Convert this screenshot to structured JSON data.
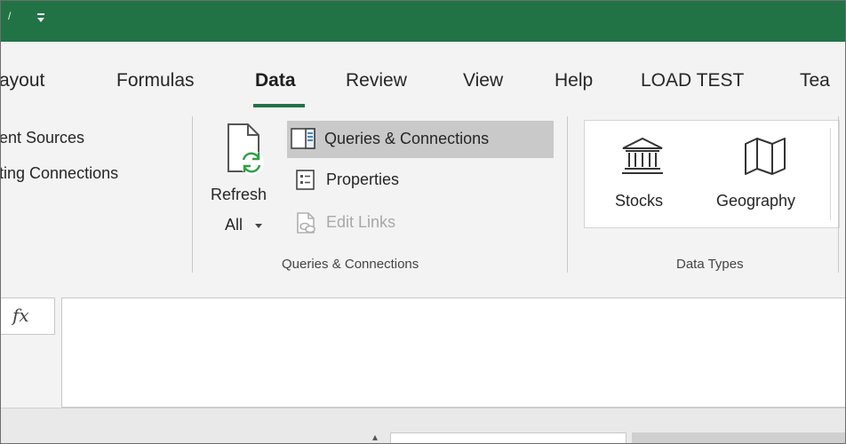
{
  "title_bar": {
    "qat_glyph": "/",
    "customize_qat_icon": "customize-quick-access-toolbar-icon"
  },
  "tabs": [
    {
      "label": "ayout"
    },
    {
      "label": "Formulas"
    },
    {
      "label": "Data",
      "active": true
    },
    {
      "label": "Review"
    },
    {
      "label": "View"
    },
    {
      "label": "Help"
    },
    {
      "label": "LOAD TEST"
    },
    {
      "label": "Tea"
    }
  ],
  "get_data_group": {
    "recent_sources": "ent Sources",
    "existing_connections": "ting Connections"
  },
  "queries_group": {
    "refresh_all_line1": "Refresh",
    "refresh_all_line2": "All",
    "queries_connections": "Queries & Connections",
    "properties": "Properties",
    "edit_links": "Edit Links",
    "group_label": "Queries & Connections"
  },
  "data_types_group": {
    "stocks": "Stocks",
    "geography": "Geography",
    "group_label": "Data Types"
  },
  "formula_bar": {
    "fx_label": "fx",
    "value": ""
  },
  "colors": {
    "excel_green": "#217346",
    "ribbon_bg": "#f3f3f3",
    "refresh_green": "#2ea043"
  }
}
